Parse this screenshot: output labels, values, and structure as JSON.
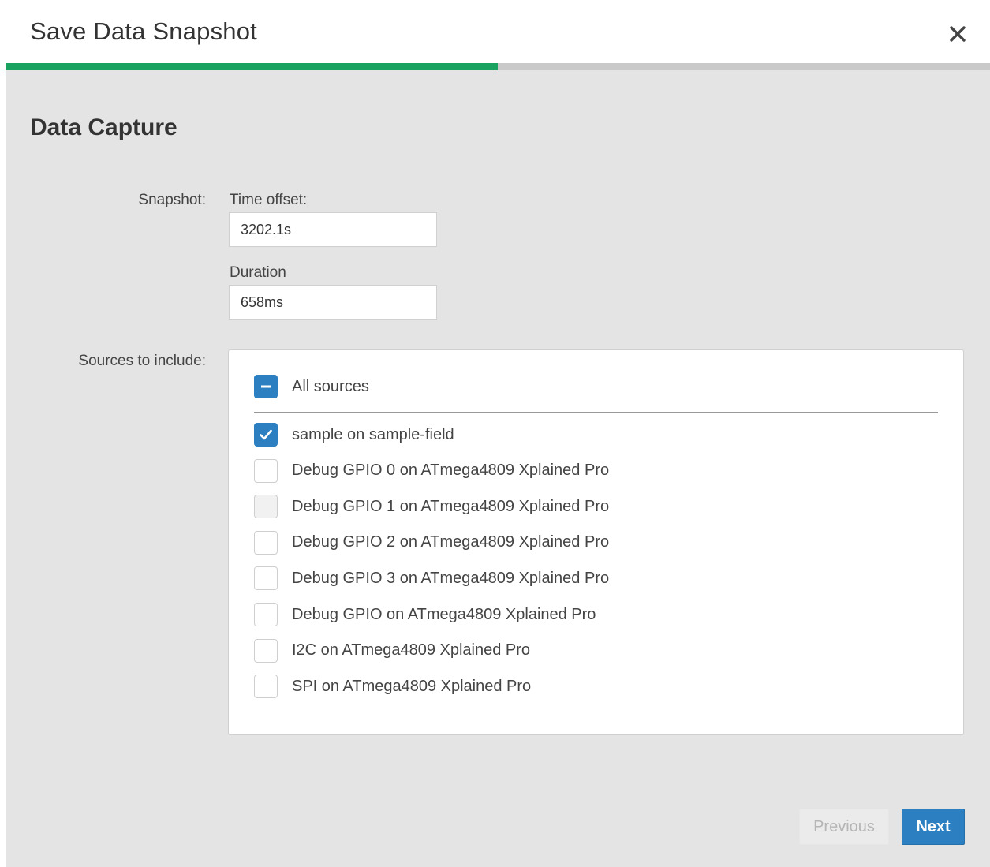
{
  "dialog": {
    "title": "Save Data Snapshot",
    "close_icon": "close-icon",
    "progress_fraction": 0.5
  },
  "section": {
    "title": "Data Capture"
  },
  "snapshot": {
    "label": "Snapshot:",
    "time_offset_label": "Time offset:",
    "time_offset_value": "3202.1s",
    "duration_label": "Duration",
    "duration_value": "658ms"
  },
  "sources": {
    "label": "Sources to include:",
    "all_label": "All sources",
    "all_state": "indeterminate",
    "items": [
      {
        "label": "sample on sample-field",
        "checked": true
      },
      {
        "label": "Debug GPIO 0 on ATmega4809 Xplained Pro",
        "checked": false
      },
      {
        "label": "Debug GPIO 1 on ATmega4809 Xplained Pro",
        "checked": false
      },
      {
        "label": "Debug GPIO 2 on ATmega4809 Xplained Pro",
        "checked": false
      },
      {
        "label": "Debug GPIO 3 on ATmega4809 Xplained Pro",
        "checked": false
      },
      {
        "label": "Debug GPIO on ATmega4809 Xplained Pro",
        "checked": false
      },
      {
        "label": "I2C on ATmega4809 Xplained Pro",
        "checked": false
      },
      {
        "label": "SPI on ATmega4809 Xplained Pro",
        "checked": false
      }
    ]
  },
  "footer": {
    "previous_label": "Previous",
    "next_label": "Next"
  },
  "colors": {
    "progress": "#1aa260",
    "accent": "#2c7fc1",
    "body_bg": "#e4e4e4"
  }
}
